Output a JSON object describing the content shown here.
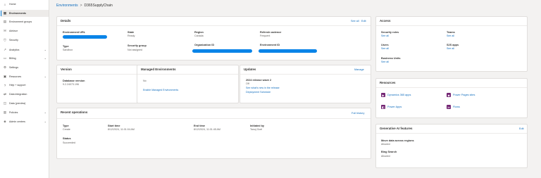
{
  "sidebar": {
    "items": [
      {
        "label": "Home",
        "icon": "home-icon",
        "glyph": "⌂"
      },
      {
        "label": "Environments",
        "icon": "environments-icon",
        "glyph": "▦",
        "active": true
      },
      {
        "label": "Environment groups",
        "icon": "environment-groups-icon",
        "glyph": "▤"
      },
      {
        "label": "Advisor",
        "icon": "advisor-icon",
        "glyph": "✉"
      },
      {
        "label": "Security",
        "icon": "security-icon",
        "glyph": "⛉"
      },
      {
        "label": "Analytics",
        "icon": "analytics-icon",
        "glyph": "↗",
        "chevron": "⌄"
      },
      {
        "label": "Billing",
        "icon": "billing-icon",
        "glyph": "▭",
        "chevron": "⌄"
      },
      {
        "label": "Settings",
        "icon": "settings-icon",
        "glyph": "⚙"
      },
      {
        "label": "Resources",
        "icon": "resources-icon",
        "glyph": "▣",
        "chevron": "⌄"
      },
      {
        "label": "Help + support",
        "icon": "help-icon",
        "glyph": "?"
      },
      {
        "label": "Data integration",
        "icon": "data-integration-icon",
        "glyph": "⇄"
      },
      {
        "label": "Data (preview)",
        "icon": "data-preview-icon",
        "glyph": "◫"
      },
      {
        "label": "Policies",
        "icon": "policies-icon",
        "glyph": "▥",
        "chevron": "⌄"
      },
      {
        "label": "Admin centers",
        "icon": "admin-centers-icon",
        "glyph": "◈",
        "chevron": "⌄"
      }
    ]
  },
  "breadcrumb": {
    "parent": "Environments",
    "separator": ">",
    "current": "D365SupplyChain"
  },
  "details": {
    "title": "Details",
    "see_all": "See all",
    "edit": "Edit",
    "environment_url_label": "Environment URL",
    "state_label": "State",
    "state_value": "Ready",
    "region_label": "Region",
    "region_value": "Canada",
    "refresh_label": "Refresh cadence",
    "refresh_value": "Frequent",
    "type_label": "Type",
    "type_value": "Sandbox",
    "security_group_label": "Security group",
    "security_group_value": "Not assigned",
    "org_id_label": "Organization ID",
    "env_id_label": "Environment ID"
  },
  "version": {
    "title": "Version",
    "db_label": "Database version",
    "db_value": "9.2.24073.196"
  },
  "managed": {
    "title": "Managed Environments",
    "status": "No",
    "enable_link": "Enable Managed Environments"
  },
  "updates": {
    "title": "Updates",
    "manage": "Manage",
    "wave_label": "2024 release wave 2",
    "wave_value": "Off",
    "whats_new": "See what's new in the release",
    "schedule": "Deployment Schedule"
  },
  "recent": {
    "title": "Recent operations",
    "full_history": "Full history",
    "type_label": "Type",
    "type_value": "Create",
    "start_label": "Start time",
    "start_value": "8/12/2024, 11:01:04 AM",
    "end_label": "End time",
    "end_value": "8/12/2024, 11:01:45 AM",
    "initiated_label": "Initiated by",
    "initiated_value": "Tanuj Goel",
    "status_label": "Status",
    "status_value": "Succeeded"
  },
  "access": {
    "title": "Access",
    "security_roles_label": "Security roles",
    "security_roles_link": "See all",
    "teams_label": "Teams",
    "teams_link": "See all",
    "users_label": "Users",
    "users_link": "See all",
    "s2s_label": "S2S apps",
    "s2s_link": "See all",
    "business_units_label": "Business Units",
    "business_units_link": "See all"
  },
  "resources": {
    "title": "Resources",
    "items": [
      {
        "label": "Dynamics 365 apps",
        "icon": "dynamics-icon",
        "glyph": "▶"
      },
      {
        "label": "Power Pages sites",
        "icon": "power-pages-icon",
        "glyph": "◆"
      },
      {
        "label": "Power Apps",
        "icon": "power-apps-icon",
        "glyph": "◧"
      },
      {
        "label": "Flows",
        "icon": "flows-icon",
        "glyph": "≫"
      }
    ]
  },
  "genai": {
    "title": "Generative AI features",
    "edit": "Edit",
    "move_label": "Move data across regions",
    "move_value": "Allowed",
    "bing_label": "Bing Search",
    "bing_value": "Allowed"
  },
  "colors": {
    "accent": "#0f6cbd",
    "redaction": "#0a84e8",
    "resource_icon": "#742774"
  }
}
